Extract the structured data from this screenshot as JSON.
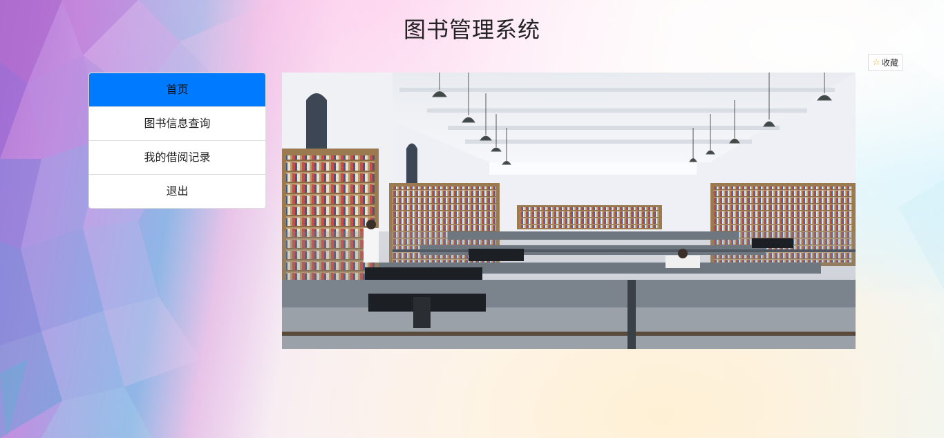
{
  "page": {
    "title": "图书管理系统"
  },
  "favorite": {
    "label": "收藏",
    "icon": "star-icon"
  },
  "menu": {
    "items": [
      {
        "label": "首页",
        "active": true
      },
      {
        "label": "图书信息查询",
        "active": false
      },
      {
        "label": "我的借阅记录",
        "active": false
      },
      {
        "label": "退出",
        "active": false
      }
    ]
  },
  "main": {
    "image": "library-reading-room-photo"
  },
  "colors": {
    "accent": "#007bff",
    "star": "#f2b01e"
  }
}
